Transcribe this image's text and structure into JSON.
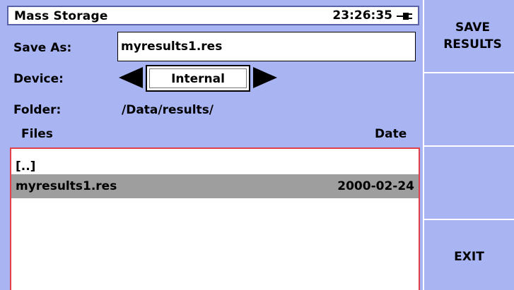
{
  "title_bar": {
    "title": "Mass Storage",
    "clock": "23:26:35",
    "power_icon": "ac-plug-icon"
  },
  "save_as": {
    "label": "Save As:",
    "value": "myresults1.res"
  },
  "device": {
    "label": "Device:",
    "value": "Internal",
    "prev_icon": "triangle-left-icon",
    "next_icon": "triangle-right-icon"
  },
  "folder": {
    "label": "Folder:",
    "path": "/Data/results/"
  },
  "file_list": {
    "columns": {
      "name": "Files",
      "date": "Date"
    },
    "rows": [
      {
        "name": "[..]",
        "date": ""
      },
      {
        "name": "myresults1.res",
        "date": "2000-02-24",
        "selected": true
      }
    ]
  },
  "softkeys": {
    "key1": "SAVE\nRESULTS",
    "key2": "",
    "key3": "",
    "key4": "EXIT"
  },
  "colors": {
    "background": "#a9b4f3",
    "list_border": "#e0404a",
    "selected_row": "#9e9e9e"
  }
}
